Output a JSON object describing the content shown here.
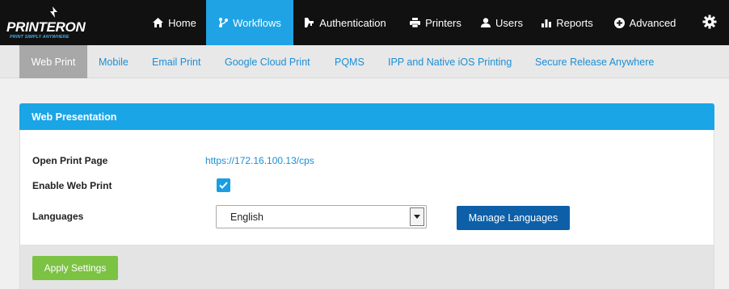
{
  "brand": {
    "name": "PRINTERON",
    "tagline": "PRINT SIMPLY ANYWHERE"
  },
  "nav": {
    "items": [
      {
        "label": "Home",
        "icon": "home-icon"
      },
      {
        "label": "Workflows",
        "icon": "workflow-icon",
        "active": true
      },
      {
        "label": "Authentication",
        "icon": "key-icon"
      },
      {
        "label": "Printers",
        "icon": "printer-icon"
      },
      {
        "label": "Users",
        "icon": "user-icon"
      },
      {
        "label": "Reports",
        "icon": "bar-chart-icon"
      },
      {
        "label": "Advanced",
        "icon": "plus-circle-icon"
      }
    ],
    "settings_icon": "gear-icon"
  },
  "subnav": {
    "items": [
      {
        "label": "Web Print",
        "active": true
      },
      {
        "label": "Mobile"
      },
      {
        "label": "Email Print"
      },
      {
        "label": "Google Cloud Print"
      },
      {
        "label": "PQMS"
      },
      {
        "label": "IPP and Native iOS Printing"
      },
      {
        "label": "Secure Release Anywhere"
      }
    ]
  },
  "panel": {
    "title": "Web Presentation",
    "open_print_page_label": "Open Print Page",
    "open_print_page_url": "https://172.16.100.13/cps",
    "enable_web_print_label": "Enable Web Print",
    "enable_web_print_checked": true,
    "languages_label": "Languages",
    "languages_selected": "English",
    "manage_languages_button": "Manage Languages",
    "apply_button": "Apply Settings"
  },
  "colors": {
    "topbar": "#111111",
    "accent_blue": "#1fa3e5",
    "dark_blue_button": "#0d5fa8",
    "green_button": "#7cc243",
    "link": "#1a8ed6"
  }
}
